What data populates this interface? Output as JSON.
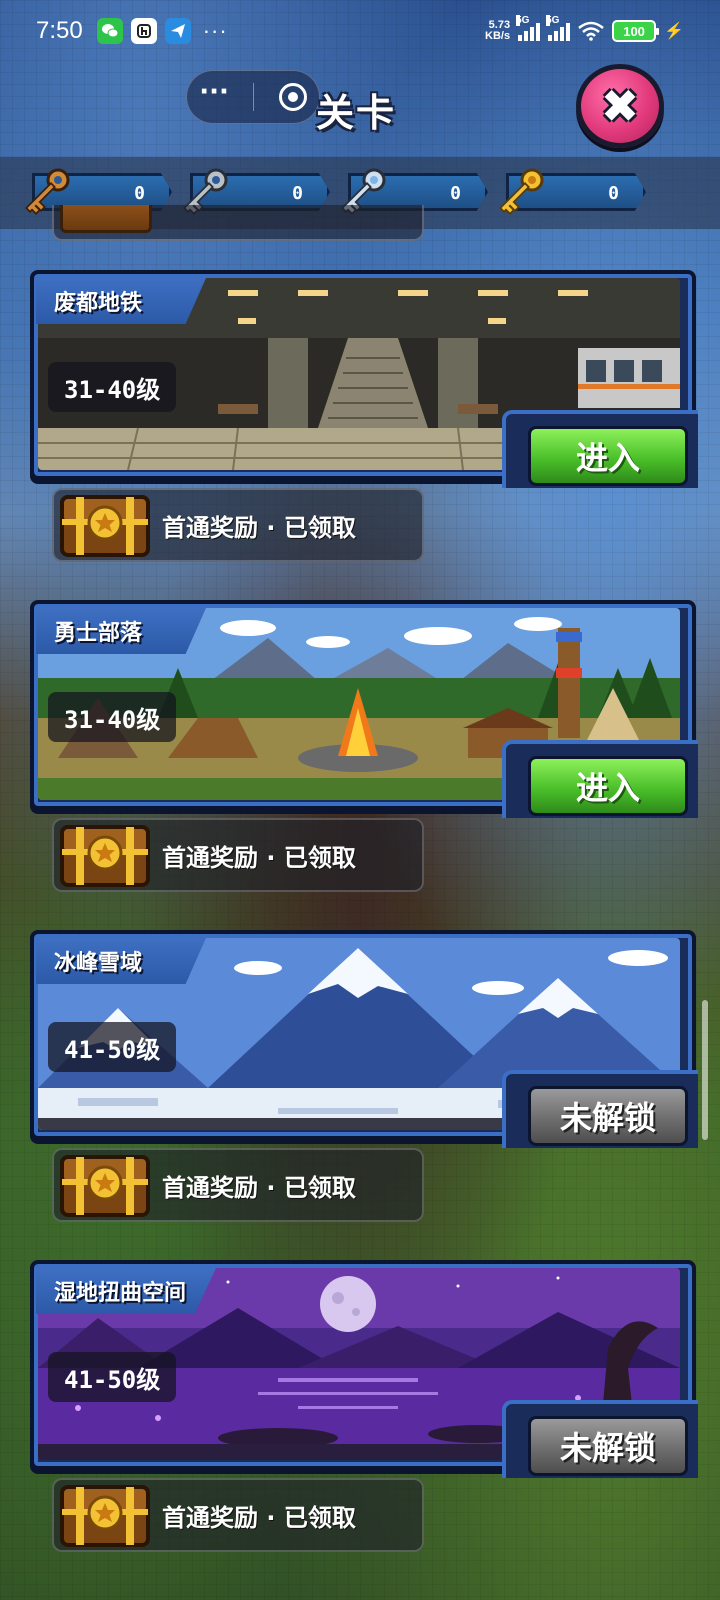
{
  "status_bar": {
    "time": "7:50",
    "net_speed_value": "5.73",
    "net_speed_unit": "KB/s",
    "signal_1": "5G",
    "signal_2": "5G",
    "battery": "100",
    "more": "···"
  },
  "header": {
    "title": "关卡",
    "capsule_more": "···"
  },
  "keys": [
    {
      "name": "bronze-key",
      "count": "0",
      "color": "#d08a3a"
    },
    {
      "name": "silver-key",
      "count": "0",
      "color": "#b8c0c8"
    },
    {
      "name": "blue-key",
      "count": "0",
      "color": "#7fb4e6"
    },
    {
      "name": "gold-key",
      "count": "0",
      "color": "#f2c234"
    }
  ],
  "levels": [
    {
      "name": "废都地铁",
      "range": "31-40级",
      "action": "进入",
      "state": "enter",
      "reward": "首通奖励 · 已领取"
    },
    {
      "name": "勇士部落",
      "range": "31-40级",
      "action": "进入",
      "state": "enter",
      "reward": "首通奖励 · 已领取"
    },
    {
      "name": "冰峰雪域",
      "range": "41-50级",
      "action": "未解锁",
      "state": "locked",
      "reward": "首通奖励 · 已领取"
    },
    {
      "name": "湿地扭曲空间",
      "range": "41-50级",
      "action": "未解锁",
      "state": "locked",
      "reward": "首通奖励 · 已领取"
    }
  ],
  "colors": {
    "enter_button": "#4bc02a",
    "locked_button": "#6e6e6e",
    "card_border": "#3b6fc6",
    "close_button": "#e23a7c"
  }
}
